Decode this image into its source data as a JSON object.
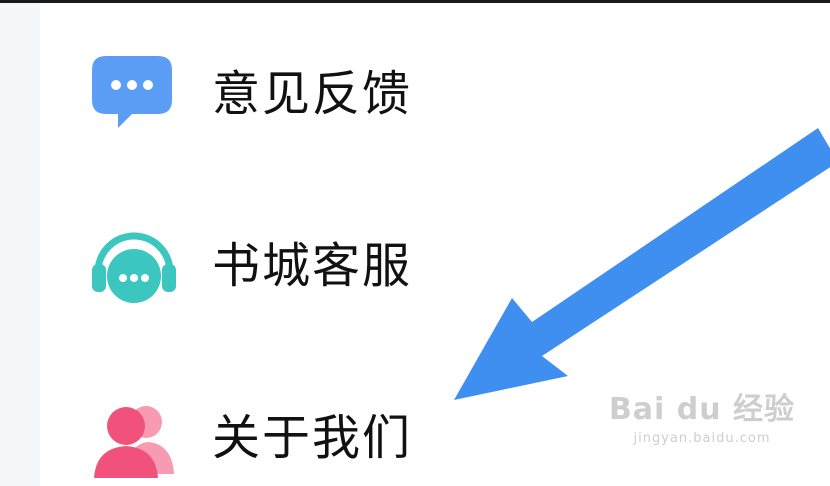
{
  "menu": {
    "items": [
      {
        "label": "意见反馈",
        "icon": "chat-bubble-icon",
        "color": "#5b9df5"
      },
      {
        "label": "书城客服",
        "icon": "headset-icon",
        "color": "#3cc6c0"
      },
      {
        "label": "关于我们",
        "icon": "users-icon",
        "color": "#f0527c"
      }
    ]
  },
  "annotation": {
    "arrow_color": "#3f8ff0"
  },
  "watermark": {
    "main": "Bai du 经验",
    "sub": "jingyan.baidu.com"
  }
}
